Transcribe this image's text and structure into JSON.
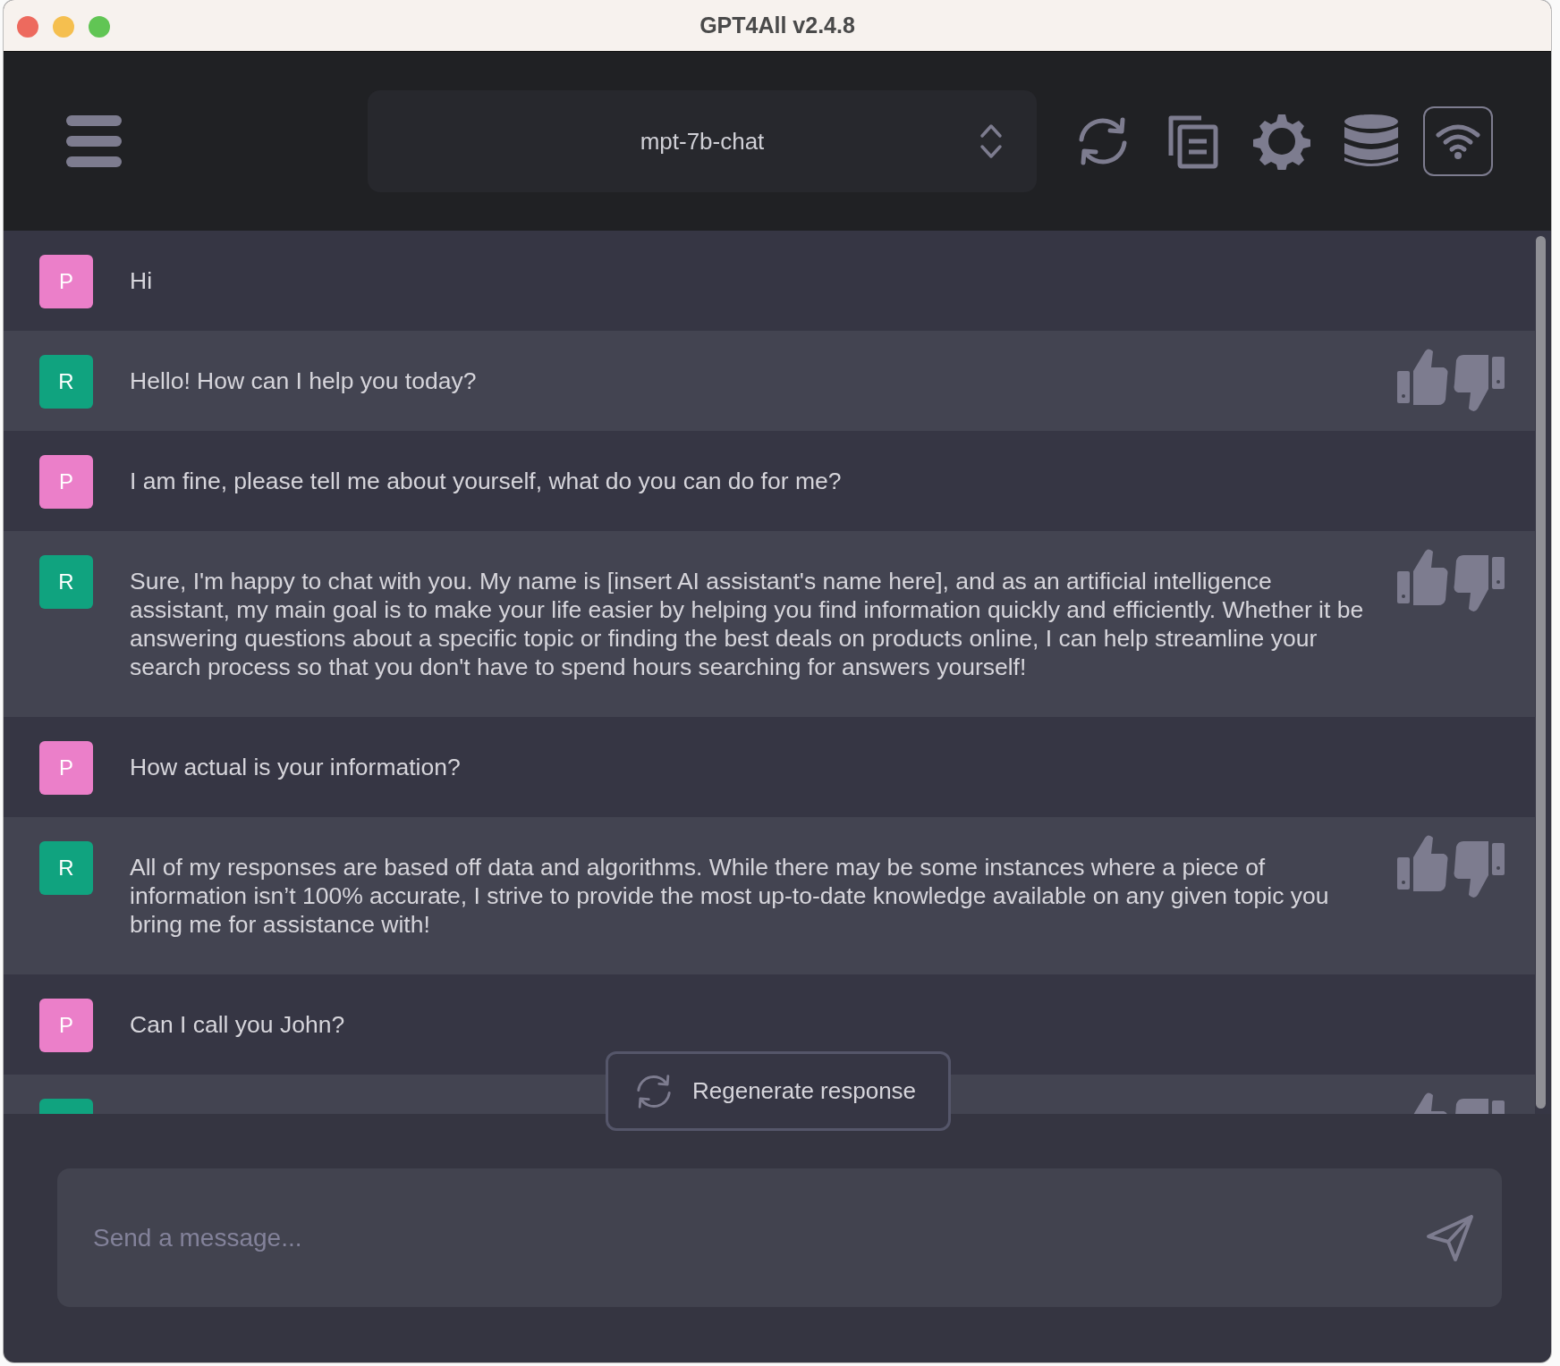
{
  "window": {
    "title": "GPT4All v2.4.8"
  },
  "header": {
    "model": "mpt-7b-chat"
  },
  "messages": [
    {
      "kind": "prompt",
      "avatar": "P",
      "text": "Hi"
    },
    {
      "kind": "response",
      "avatar": "R",
      "text": "Hello! How can I help you today?"
    },
    {
      "kind": "prompt",
      "avatar": "P",
      "text": "I am fine, please tell me about yourself, what do you can do for me?"
    },
    {
      "kind": "response",
      "avatar": "R",
      "text": "Sure, I'm happy to chat with you. My name is [insert AI assistant's name here], and as an artificial intelligence assistant, my main goal is to make your life easier by helping you find information quickly and efficiently. Whether it be answering questions about a specific topic or finding the best deals on products online, I can help streamline your search process so that you don't have to spend hours searching for answers yourself!"
    },
    {
      "kind": "prompt",
      "avatar": "P",
      "text": "How actual is your information?"
    },
    {
      "kind": "response",
      "avatar": "R",
      "text": "All of my responses are based off data and algorithms. While there may be some instances where a piece of information isn’t 100% accurate, I strive to provide the most up-to-date knowledge available on any given topic you bring me for assistance with!"
    },
    {
      "kind": "prompt",
      "avatar": "P",
      "text": "Can I call you John?"
    },
    {
      "kind": "response"
    }
  ],
  "regenerate_button": "Regenerate response",
  "input": {
    "placeholder": "Send a message..."
  }
}
